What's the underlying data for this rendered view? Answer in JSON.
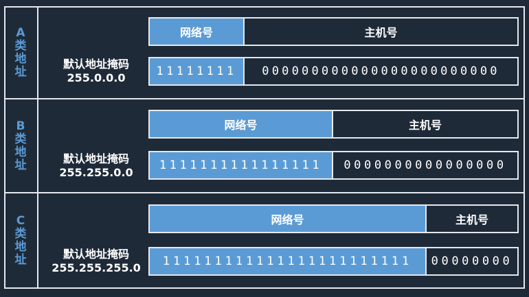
{
  "classes": [
    {
      "label_chars": [
        "A",
        "类",
        "地",
        "址"
      ],
      "network_label": "网络号",
      "host_label": "主机号",
      "mask_title": "默认地址掩码",
      "mask_value": "255.0.0.0",
      "network_bits": "11111111",
      "host_bits": "000000000000000000000000"
    },
    {
      "label_chars": [
        "B",
        "类",
        "地",
        "址"
      ],
      "network_label": "网络号",
      "host_label": "主机号",
      "mask_title": "默认地址掩码",
      "mask_value": "255.255.0.0",
      "network_bits": "1111111111111111",
      "host_bits": "0000000000000000"
    },
    {
      "label_chars": [
        "C",
        "类",
        "地",
        "址"
      ],
      "network_label": "网络号",
      "host_label": "主机号",
      "mask_title": "默认地址掩码",
      "mask_value": "255.255.255.0",
      "network_bits": "111111111111111111111111",
      "host_bits": "00000000"
    }
  ],
  "colors": {
    "background": "#1f2a38",
    "network_fill": "#5b9bd5",
    "border": "#e6e9ee",
    "class_label": "#5b9bd5"
  }
}
